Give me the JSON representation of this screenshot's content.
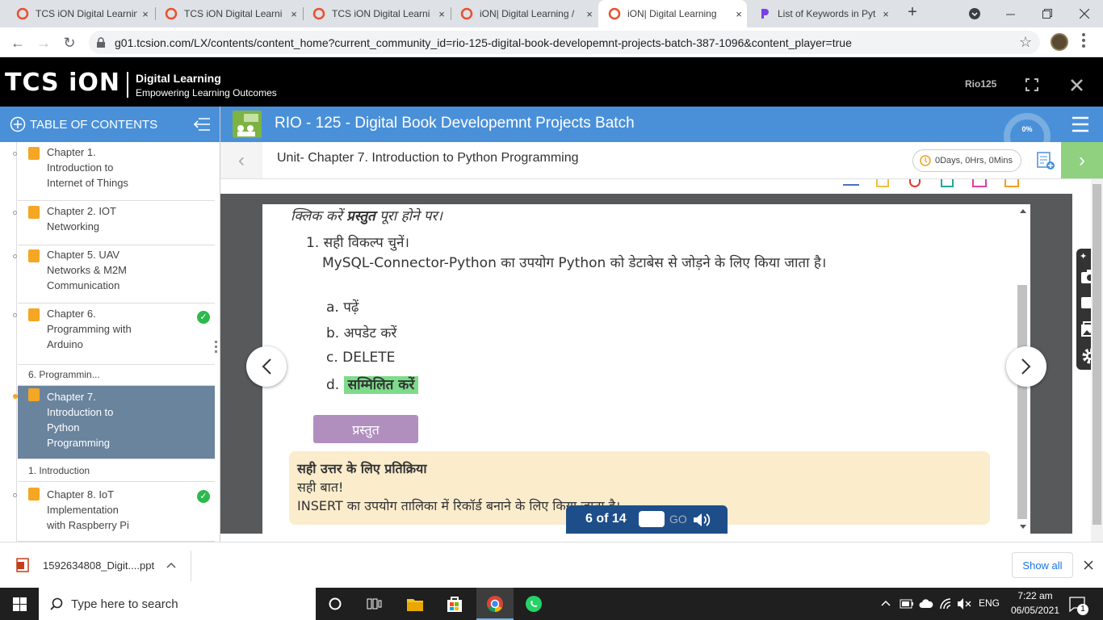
{
  "browser": {
    "tabs": [
      {
        "label": "TCS iON Digital Learnin",
        "close": "×",
        "favicon": "tcs-icon"
      },
      {
        "label": "TCS iON Digital Learni",
        "close": "×",
        "favicon": "tcs-icon"
      },
      {
        "label": "TCS iON Digital Learni",
        "close": "×",
        "favicon": "tcs-icon"
      },
      {
        "label": "iON| Digital Learning /",
        "close": "×",
        "favicon": "tcs-icon"
      },
      {
        "label": "iON| Digital Learning",
        "close": "×",
        "favicon": "tcs-icon",
        "active": true
      },
      {
        "label": "List of Keywords in Pyt",
        "close": "×",
        "favicon": "p-icon"
      }
    ],
    "new_tab": "+",
    "url": "g01.tcsion.com/LX/contents/content_home?current_community_id=rio-125-digital-book-developemnt-projects-batch-387-1096&content_player=true"
  },
  "app_header": {
    "logo": "TCS iON",
    "brand_title": "Digital Learning",
    "brand_tagline": "Empowering Learning Outcomes",
    "user": "Rio125"
  },
  "toc": {
    "title": "TABLE OF CONTENTS",
    "items": [
      {
        "label": "Chapter 1. Introduction to Internet of Things",
        "lines": [
          "Chapter 1.",
          "Introduction to",
          "Internet of Things"
        ],
        "done": false
      },
      {
        "label": "Chapter 2. IOT Networking",
        "lines": [
          "Chapter 2. IOT",
          "Networking"
        ],
        "done": false
      },
      {
        "label": "Chapter 5. UAV Networks & M2M Communication",
        "lines": [
          "Chapter 5. UAV",
          "Networks & M2M",
          "Communication"
        ],
        "done": false
      },
      {
        "label": "Chapter 6. Programming with Arduino",
        "lines": [
          "Chapter 6.",
          "Programming with",
          "Arduino"
        ],
        "done": true
      },
      {
        "label": "Chapter 7. Introduction to Python Programming",
        "lines": [
          "Chapter 7.",
          "Introduction to",
          "Python",
          "Programming"
        ],
        "done": false,
        "active": true
      },
      {
        "label": "Chapter 8. IoT Implementation with Raspberry Pi",
        "lines": [
          "Chapter 8. IoT",
          "Implementation",
          "with Raspberry Pi"
        ],
        "done": true
      }
    ],
    "subs": [
      "6. Programmin...",
      "1. Introduction"
    ]
  },
  "course": {
    "title": "RIO - 125 - Digital Book Developemnt Projects Batch",
    "progress": "0%",
    "unit": "Unit- Chapter 7. Introduction to Python Programming",
    "timer": "0Days, 0Hrs, 0Mins"
  },
  "quiz": {
    "instruction_a": "क्लिक करें ",
    "instruction_b": "प्रस्तुत",
    "instruction_c": " पूरा होने पर।",
    "q_no": "1.",
    "question_title": "सही विकल्प चुनें।",
    "question_body": "MySQL-Connector-Python का उपयोग Python को डेटाबेस से जोड़ने के लिए किया जाता है।",
    "options": [
      {
        "key": "a.",
        "text": "पढ़ें"
      },
      {
        "key": "b.",
        "text": "अपडेट करें"
      },
      {
        "key": "c.",
        "text": "DELETE"
      },
      {
        "key": "d.",
        "text": "सम्मिलित करें",
        "selected": true
      }
    ],
    "submit_label": "प्रस्तुत",
    "feedback_title": "सही उत्तर के लिए प्रतिक्रिया",
    "feedback_line1": "सही बात!",
    "feedback_line2": "INSERT का उपयोग तालिका में रिकॉर्ड बनाने के लिए किया जाता है।"
  },
  "pager": {
    "current": "6 of 14",
    "go": "GO"
  },
  "download": {
    "file": "1592634808_Digit....ppt",
    "show_all": "Show all"
  },
  "taskbar": {
    "search_placeholder": "Type here to search",
    "lang": "ENG",
    "time": "7:22 am",
    "date": "06/05/2021",
    "notifications": "1"
  },
  "colors": {
    "accent": "#4a90d9",
    "selected_option": "#7ddc8b",
    "submit": "#b08fbf",
    "feedback_bg": "#fbeccc",
    "pager": "#1d4e8a"
  }
}
